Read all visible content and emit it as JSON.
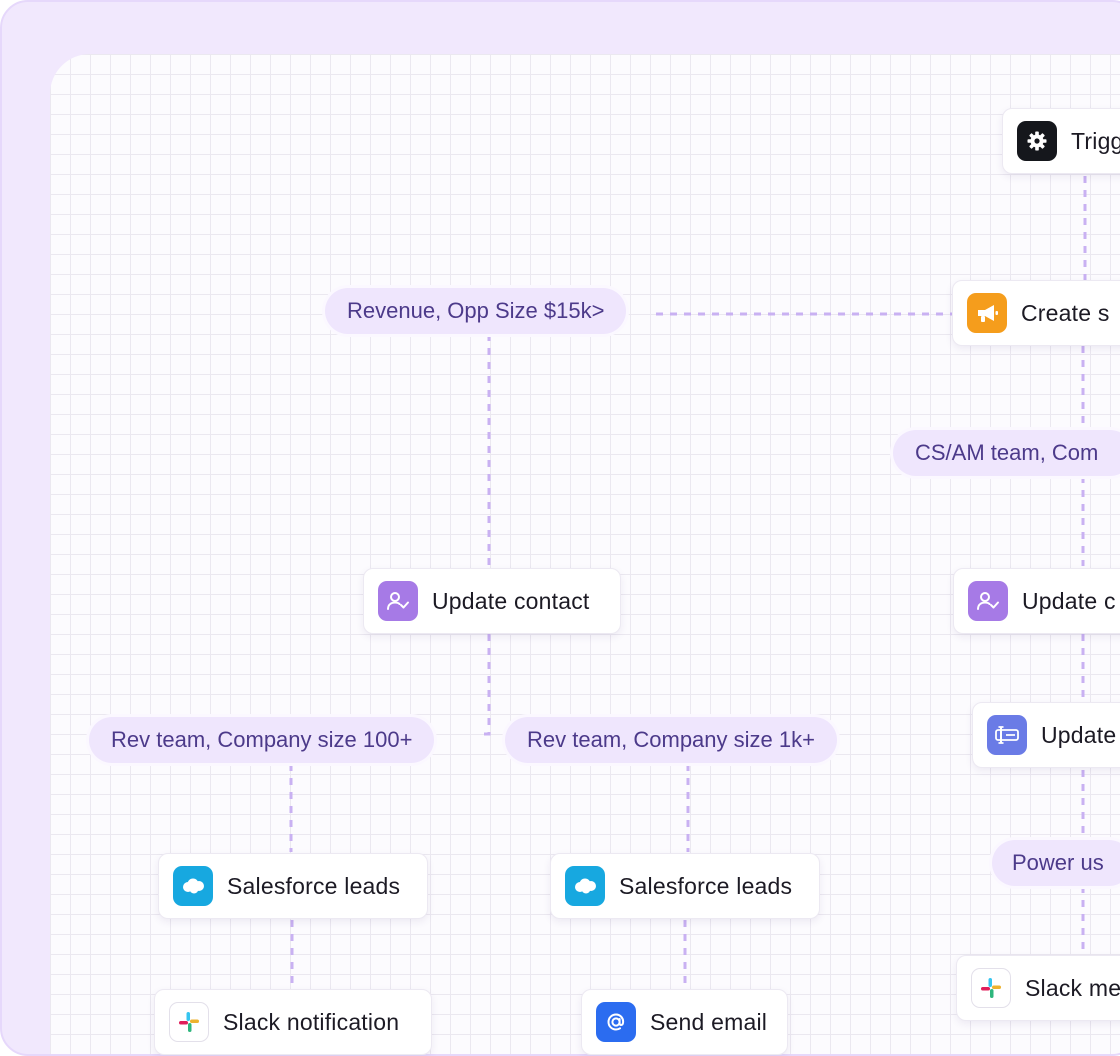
{
  "colors": {
    "frame": "#f1e8fd",
    "pill_bg": "#efe6fd",
    "pill_text": "#4c3a8a",
    "connector": "#c9b1f2",
    "gear_icon_bg": "#15171c",
    "megaphone_icon_bg": "#f59d1c",
    "contact_icon_bg": "#a67ae6",
    "form_icon_bg": "#6a7be6",
    "salesforce_icon_bg": "#17a8e0",
    "email_icon_bg": "#2b6cf0"
  },
  "nodes": {
    "trigger": {
      "label": "Trigg",
      "icon": "gear-icon"
    },
    "create_step": {
      "label": "Create s",
      "icon": "megaphone-icon"
    },
    "update_contact_left": {
      "label": "Update contact",
      "icon": "user-check-icon"
    },
    "update_contact_right": {
      "label": "Update c",
      "icon": "user-check-icon"
    },
    "update_field": {
      "label": "Update",
      "icon": "text-field-icon"
    },
    "salesforce_leads_1": {
      "label": "Salesforce leads",
      "icon": "salesforce-icon"
    },
    "salesforce_leads_2": {
      "label": "Salesforce leads",
      "icon": "salesforce-icon"
    },
    "slack_notification": {
      "label": "Slack notification",
      "icon": "slack-icon"
    },
    "send_email": {
      "label": "Send email",
      "icon": "at-sign-icon"
    },
    "slack_message": {
      "label": "Slack me",
      "icon": "slack-icon"
    }
  },
  "conditions": {
    "revenue": "Revenue, Opp Size $15k>",
    "cs_am": "CS/AM team, Com",
    "rev_team_100": "Rev team, Company size 100+",
    "rev_team_1k": "Rev team, Company size 1k+",
    "power_users": "Power us"
  }
}
